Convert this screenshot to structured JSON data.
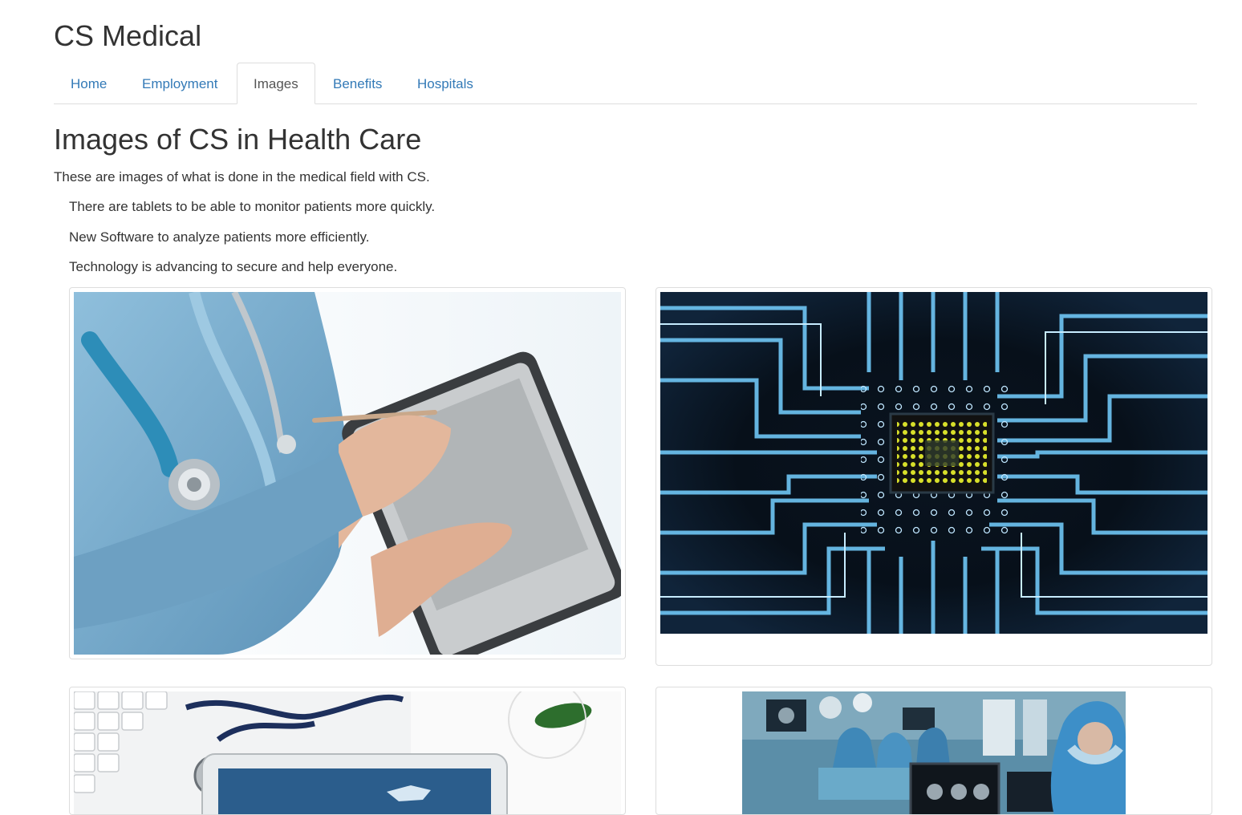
{
  "site": {
    "title": "CS Medical"
  },
  "nav": {
    "tabs": [
      {
        "label": "Home",
        "active": false
      },
      {
        "label": "Employment",
        "active": false
      },
      {
        "label": "Images",
        "active": true
      },
      {
        "label": "Benefits",
        "active": false
      },
      {
        "label": "Hospitals",
        "active": false
      }
    ]
  },
  "main": {
    "heading": "Images of CS in Health Care",
    "intro": "These are images of what is done in the medical field with CS.",
    "points": [
      "There are tablets to be able to monitor patients more quickly.",
      "New Software to analyze patients more efficiently.",
      "Technology is advancing to secure and help everyone."
    ],
    "images": [
      {
        "subject": "nurse-tablet-image"
      },
      {
        "subject": "circuit-board-chip-image"
      },
      {
        "subject": "stethoscope-keyboard-tablet-image"
      },
      {
        "subject": "operating-room-image"
      }
    ]
  },
  "colors": {
    "link": "#337ab7",
    "text": "#333333",
    "border": "#dddddd",
    "active_tab_text": "#555555"
  }
}
